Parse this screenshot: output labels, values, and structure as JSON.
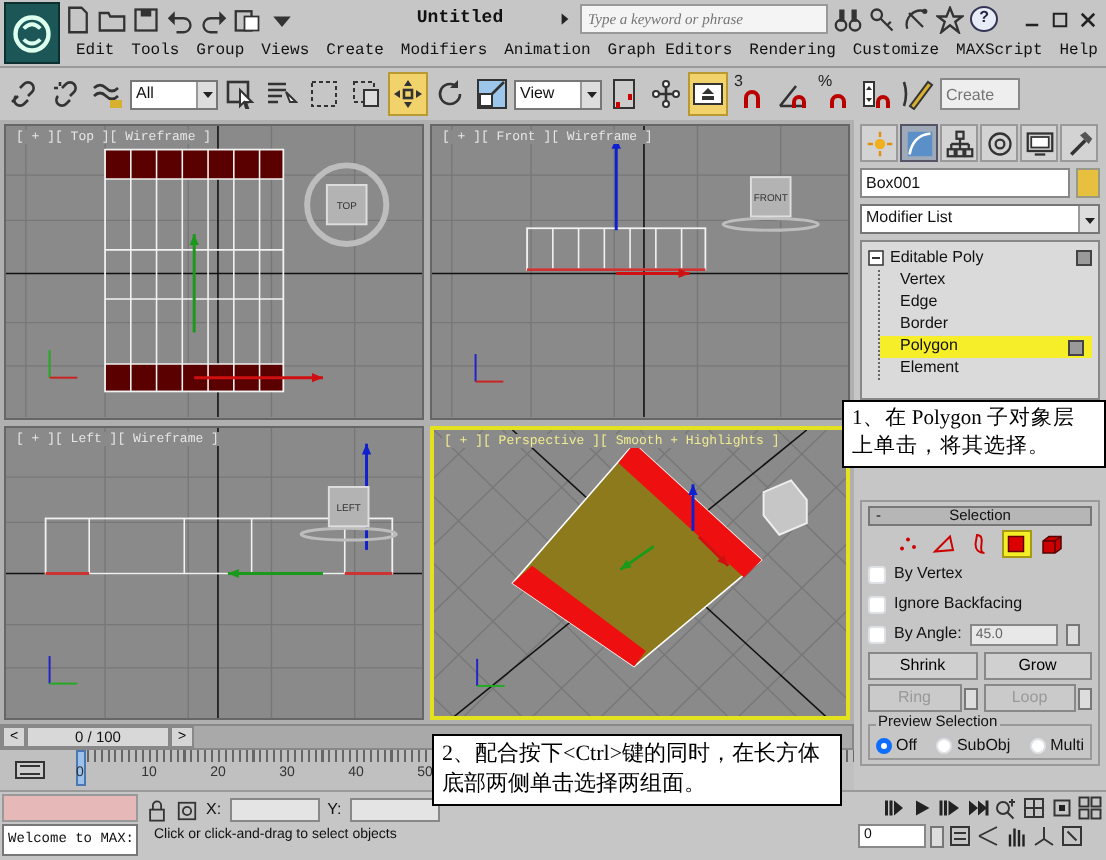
{
  "title_bar": {
    "title": "Untitled",
    "search": {
      "placeholder": "Type a keyword or phrase"
    },
    "help": "?"
  },
  "menu": [
    "Edit",
    "Tools",
    "Group",
    "Views",
    "Create",
    "Modifiers",
    "Animation",
    "Graph Editors",
    "Rendering",
    "Customize",
    "MAXScript",
    "Help"
  ],
  "toolbar": [
    {
      "kind": "link",
      "active": false
    },
    {
      "kind": "unlink",
      "active": false
    },
    {
      "kind": "bind",
      "active": false
    },
    {
      "kind": "dropdown",
      "value": "All"
    },
    {
      "kind": "select",
      "active": false
    },
    {
      "kind": "select-by-name",
      "active": false
    },
    {
      "kind": "region",
      "active": false
    },
    {
      "kind": "crossing",
      "active": false
    },
    {
      "kind": "move",
      "active": true
    },
    {
      "kind": "rotate",
      "active": false
    },
    {
      "kind": "scale",
      "active": false
    },
    {
      "kind": "dropdown",
      "value": "View"
    },
    {
      "kind": "pivot",
      "active": false
    },
    {
      "kind": "manipulate",
      "active": false
    },
    {
      "kind": "shortcut",
      "active": true
    },
    {
      "kind": "snap",
      "label": "3",
      "active": false
    },
    {
      "kind": "angle-snap",
      "active": false
    },
    {
      "kind": "percent-snap",
      "label": "%",
      "active": false
    },
    {
      "kind": "spinner-snap",
      "active": false
    },
    {
      "kind": "edit-named",
      "active": false
    },
    {
      "kind": "field",
      "placeholder": "Create"
    }
  ],
  "viewports": [
    {
      "kind": "top",
      "label": "[ + ][ Top ][ Wireframe ]",
      "cube": "TOP",
      "active": false
    },
    {
      "kind": "front",
      "label": "[ + ][ Front ][ Wireframe ]",
      "cube": "FRONT",
      "active": false
    },
    {
      "kind": "left",
      "label": "[ + ][ Left ][ Wireframe ]",
      "cube": "LEFT",
      "active": false
    },
    {
      "kind": "perspective",
      "label": "[ + ][ Perspective ][ Smooth + Highlights ]",
      "active": true
    }
  ],
  "command_panel": {
    "tabs": [
      {
        "kind": "create",
        "selected": false
      },
      {
        "kind": "modify",
        "selected": true
      },
      {
        "kind": "hierarchy",
        "selected": false
      },
      {
        "kind": "motion",
        "selected": false
      },
      {
        "kind": "display",
        "selected": false
      },
      {
        "kind": "utilities",
        "selected": false
      }
    ],
    "object_name": "Box001",
    "modifier_list": "Modifier List",
    "stack": [
      {
        "label": "Editable Poly",
        "expanded": true,
        "children": [
          {
            "label": "Vertex",
            "selected": false
          },
          {
            "label": "Edge",
            "selected": false
          },
          {
            "label": "Border",
            "selected": false
          },
          {
            "label": "Polygon",
            "selected": true
          },
          {
            "label": "Element",
            "selected": false
          }
        ]
      }
    ],
    "selection": {
      "toggle": "-",
      "title": "Selection",
      "levels": [
        {
          "kind": "vertex",
          "selected": false
        },
        {
          "kind": "edge",
          "selected": false
        },
        {
          "kind": "border",
          "selected": false
        },
        {
          "kind": "polygon",
          "selected": true
        },
        {
          "kind": "element",
          "selected": false
        }
      ],
      "checkboxes": [
        {
          "label": "By Vertex",
          "checked": false
        },
        {
          "label": "Ignore Backfacing",
          "checked": false
        },
        {
          "label": "By Angle:",
          "checked": false,
          "value": "45.0"
        }
      ],
      "buttons": [
        {
          "label": "Shrink",
          "disabled": false,
          "spinner": false
        },
        {
          "label": "Grow",
          "disabled": false,
          "spinner": false
        },
        {
          "label": "Ring",
          "disabled": true,
          "spinner": true
        },
        {
          "label": "Loop",
          "disabled": true,
          "spinner": true
        }
      ],
      "preview": {
        "title": "Preview Selection",
        "options": [
          {
            "label": "Off",
            "selected": true
          },
          {
            "label": "SubObj",
            "selected": false
          },
          {
            "label": "Multi",
            "selected": false
          }
        ]
      }
    }
  },
  "timeline": {
    "slider": "0 / 100",
    "prev": "<",
    "next": ">",
    "ticks": [
      "0",
      "10",
      "20",
      "30",
      "40",
      "50"
    ]
  },
  "status": {
    "welcome": "Welcome to MAX:",
    "prompt": "Click or click-and-drag to select objects",
    "x_label": "X:",
    "y_label": "Y:",
    "frame": "0"
  },
  "callouts": [
    {
      "text": "1、在 Polygon 子对象层上单击，将其选择。"
    },
    {
      "text": "2、配合按下<Ctrl>键的同时，在长方体底部两侧单击选择两组面。"
    }
  ]
}
